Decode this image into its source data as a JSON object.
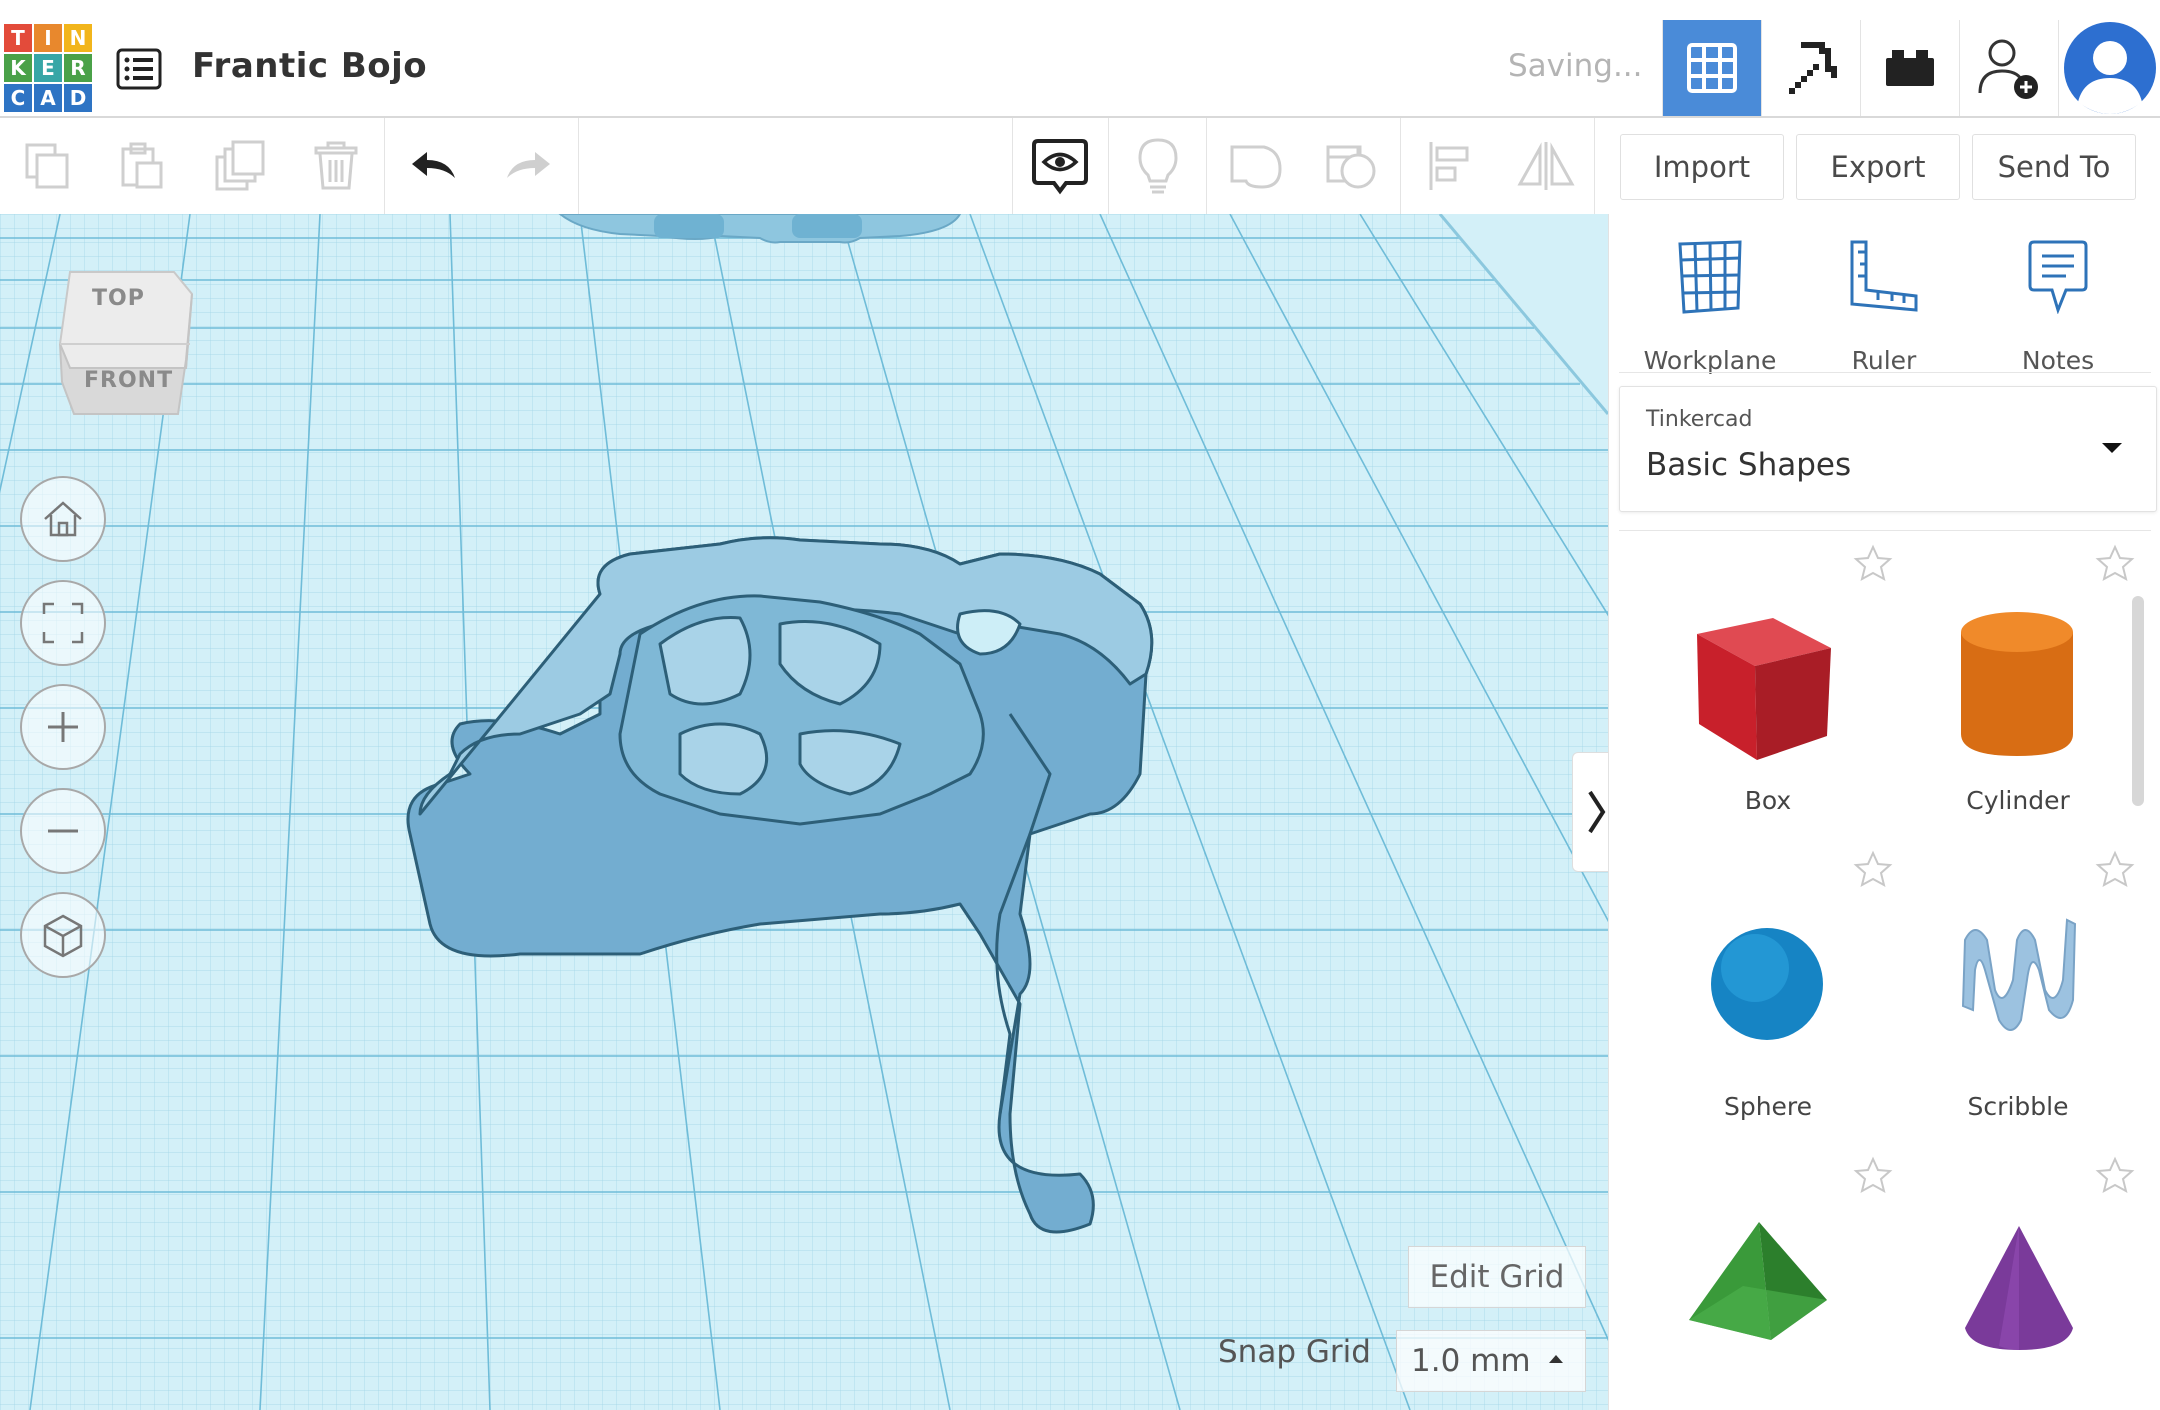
{
  "logo": {
    "letters": [
      "T",
      "I",
      "N",
      "K",
      "E",
      "R",
      "C",
      "A",
      "D"
    ]
  },
  "header": {
    "title": "Frantic Bojo",
    "status": "Saving..."
  },
  "toolbar": {
    "import_label": "Import",
    "export_label": "Export",
    "send_to_label": "Send To"
  },
  "viewcube": {
    "top": "TOP",
    "front": "FRONT"
  },
  "panel": {
    "tools": [
      {
        "label": "Workplane",
        "icon": "workplane-icon"
      },
      {
        "label": "Ruler",
        "icon": "ruler-icon"
      },
      {
        "label": "Notes",
        "icon": "notes-icon"
      }
    ],
    "library": {
      "provider": "Tinkercad",
      "selected": "Basic Shapes"
    },
    "shapes": [
      {
        "label": "Box",
        "color": "#c8202b"
      },
      {
        "label": "Cylinder",
        "color": "#e07818"
      },
      {
        "label": "Sphere",
        "color": "#1a8ed0"
      },
      {
        "label": "Scribble",
        "color": "#8bb2d6"
      },
      {
        "label": "",
        "color": "#3a9a3a"
      },
      {
        "label": "",
        "color": "#7a3a9a"
      }
    ]
  },
  "workplane": {
    "edit_grid_label": "Edit Grid",
    "snap_grid_label": "Snap Grid",
    "snap_grid_value": "1.0 mm",
    "model_color": "#7bb5d5"
  }
}
